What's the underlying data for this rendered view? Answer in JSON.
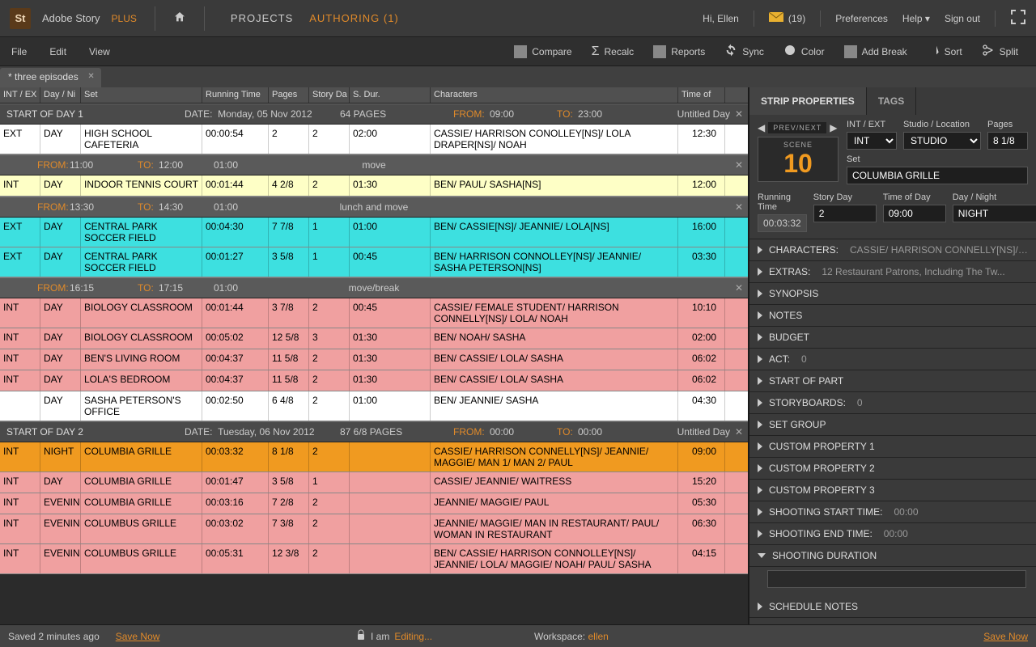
{
  "brand": {
    "product": "Adobe Story",
    "tier": "PLUS",
    "nav": {
      "projects": "PROJECTS",
      "authoring": "AUTHORING (1)"
    },
    "greeting": "Hi, Ellen",
    "mail_count": "(19)",
    "prefs": "Preferences",
    "help": "Help",
    "signout": "Sign out"
  },
  "menu": {
    "file": "File",
    "edit": "Edit",
    "view": "View",
    "tools": {
      "compare": "Compare",
      "recalc": "Recalc",
      "reports": "Reports",
      "sync": "Sync",
      "color": "Color",
      "addbreak": "Add Break",
      "sort": "Sort",
      "split": "Split"
    }
  },
  "tab": {
    "title": "* three episodes"
  },
  "cols": {
    "ie": "INT / EX",
    "dn": "Day / Ni",
    "set": "Set",
    "rt": "Running Time",
    "pg": "Pages",
    "sd": "Story Da",
    "sdur": "S. Dur.",
    "ch": "Characters",
    "to": "Time of"
  },
  "days": [
    {
      "title": "START OF DAY  1",
      "date": "Monday, 05 Nov 2012",
      "pages": "64  PAGES",
      "from": "09:00",
      "to": "23:00",
      "name": "Untitled Day"
    },
    {
      "title": "START OF DAY  2",
      "date": "Tuesday, 06 Nov 2012",
      "pages": "87 6/8  PAGES",
      "from": "00:00",
      "to": "00:00",
      "name": "Untitled Day"
    }
  ],
  "breaks": [
    {
      "from": "11:00",
      "to": "12:00",
      "dur": "01:00",
      "name": "move"
    },
    {
      "from": "13:30",
      "to": "14:30",
      "dur": "01:00",
      "name": "lunch and move"
    },
    {
      "from": "16:15",
      "to": "17:15",
      "dur": "01:00",
      "name": "move/break"
    }
  ],
  "strips": [
    {
      "c": "white",
      "ie": "EXT",
      "dn": "DAY",
      "set": "HIGH SCHOOL CAFETERIA",
      "rt": "00:00:54",
      "pg": "2",
      "sd": "2",
      "sdur": "02:00",
      "ch": "CASSIE/ HARRISON CONOLLEY[NS]/ LOLA DRAPER[NS]/ NOAH",
      "to": "12:30"
    },
    {
      "c": "yellow",
      "ie": "INT",
      "dn": "DAY",
      "set": "INDOOR TENNIS COURT",
      "rt": "00:01:44",
      "pg": "4 2/8",
      "sd": "2",
      "sdur": "01:30",
      "ch": "BEN/ PAUL/ SASHA[NS]",
      "to": "12:00"
    },
    {
      "c": "cyan",
      "ie": "EXT",
      "dn": "DAY",
      "set": "CENTRAL PARK SOCCER FIELD",
      "rt": "00:04:30",
      "pg": "7 7/8",
      "sd": "1",
      "sdur": "01:00",
      "ch": "BEN/ CASSIE[NS]/ JEANNIE/ LOLA[NS]",
      "to": "16:00"
    },
    {
      "c": "cyan",
      "ie": "EXT",
      "dn": "DAY",
      "set": "CENTRAL PARK SOCCER FIELD",
      "rt": "00:01:27",
      "pg": "3 5/8",
      "sd": "1",
      "sdur": "00:45",
      "ch": "BEN/ HARRISON CONNOLLEY[NS]/ JEANNIE/ SASHA PETERSON[NS]",
      "to": "03:30"
    },
    {
      "c": "pink",
      "ie": "INT",
      "dn": "DAY",
      "set": "BIOLOGY CLASSROOM",
      "rt": "00:01:44",
      "pg": "3 7/8",
      "sd": "2",
      "sdur": "00:45",
      "ch": "CASSIE/ FEMALE STUDENT/ HARRISON CONNELLY[NS]/ LOLA/ NOAH",
      "to": "10:10"
    },
    {
      "c": "pink",
      "ie": "INT",
      "dn": "DAY",
      "set": "BIOLOGY CLASSROOM",
      "rt": "00:05:02",
      "pg": "12 5/8",
      "sd": "3",
      "sdur": "01:30",
      "ch": "BEN/ NOAH/ SASHA",
      "to": "02:00"
    },
    {
      "c": "pink",
      "ie": "INT",
      "dn": "DAY",
      "set": "BEN'S LIVING ROOM",
      "rt": "00:04:37",
      "pg": "11 5/8",
      "sd": "2",
      "sdur": "01:30",
      "ch": "BEN/ CASSIE/ LOLA/ SASHA",
      "to": "06:02"
    },
    {
      "c": "pink",
      "ie": "INT",
      "dn": "DAY",
      "set": "LOLA'S BEDROOM",
      "rt": "00:04:37",
      "pg": "11 5/8",
      "sd": "2",
      "sdur": "01:30",
      "ch": "BEN/ CASSIE/ LOLA/ SASHA",
      "to": "06:02"
    },
    {
      "c": "white",
      "ie": "",
      "dn": "DAY",
      "set": "SASHA PETERSON'S OFFICE",
      "rt": "00:02:50",
      "pg": "6 4/8",
      "sd": "2",
      "sdur": "01:00",
      "ch": "BEN/ JEANNIE/ SASHA",
      "to": "04:30"
    },
    {
      "c": "orange",
      "ie": "INT",
      "dn": "NIGHT",
      "set": "COLUMBIA GRILLE",
      "rt": "00:03:32",
      "pg": "8 1/8",
      "sd": "2",
      "sdur": "",
      "ch": "CASSIE/ HARRISON CONNELLY[NS]/ JEANNIE/ MAGGIE/ MAN 1/ MAN 2/ PAUL",
      "to": "09:00"
    },
    {
      "c": "pink",
      "ie": "INT",
      "dn": "DAY",
      "set": "COLUMBIA GRILLE",
      "rt": "00:01:47",
      "pg": "3 5/8",
      "sd": "1",
      "sdur": "",
      "ch": "CASSIE/ JEANNIE/ WAITRESS",
      "to": "15:20"
    },
    {
      "c": "pink",
      "ie": "INT",
      "dn": "EVENING",
      "set": "COLUMBIA GRILLE",
      "rt": "00:03:16",
      "pg": "7 2/8",
      "sd": "2",
      "sdur": "",
      "ch": "JEANNIE/ MAGGIE/ PAUL",
      "to": "05:30"
    },
    {
      "c": "pink",
      "ie": "INT",
      "dn": "EVENING",
      "set": "COLUMBUS GRILLE",
      "rt": "00:03:02",
      "pg": "7 3/8",
      "sd": "2",
      "sdur": "",
      "ch": "JEANNIE/ MAGGIE/ MAN IN RESTAURANT/ PAUL/ WOMAN IN RESTAURANT",
      "to": "06:30"
    },
    {
      "c": "pink",
      "ie": "INT",
      "dn": "EVENING",
      "set": "COLUMBUS GRILLE",
      "rt": "00:05:31",
      "pg": "12 3/8",
      "sd": "2",
      "sdur": "",
      "ch": "BEN/ CASSIE/ HARRISON CONNOLLEY[NS]/ JEANNIE/ LOLA/ MAGGIE/ NOAH/ PAUL/ SASHA",
      "to": "04:15"
    }
  ],
  "labels": {
    "from": "FROM:",
    "to": "TO:",
    "date": "DATE:"
  },
  "side": {
    "tabs": {
      "props": "STRIP PROPERTIES",
      "tags": "TAGS"
    },
    "prevnext": "PREV/NEXT",
    "scene_lbl": "SCENE",
    "scene_num": "10",
    "intext_lbl": "INT / EXT",
    "intext": "INT",
    "studio_lbl": "Studio / Location",
    "studio": "STUDIO",
    "pages_lbl": "Pages",
    "pages": "8 1/8",
    "set_lbl": "Set",
    "set": "COLUMBIA GRILLE",
    "rt_lbl": "Running Time",
    "rt": "00:03:32",
    "sd_lbl": "Story Day",
    "sd": "2",
    "tod_lbl": "Time of Day",
    "tod": "09:00",
    "dn_lbl": "Day / Night",
    "dn": "NIGHT",
    "acc": {
      "characters_k": "CHARACTERS:",
      "characters_v": "CASSIE/ HARRISON CONNELLY[NS]/ JEA...",
      "extras_k": "EXTRAS:",
      "extras_v": "12 Restaurant Patrons, Including The Tw...",
      "synopsis": "SYNOPSIS",
      "notes": "NOTES",
      "budget": "BUDGET",
      "act_k": "ACT:",
      "act_v": "0",
      "startpart": "START OF PART",
      "storyboards_k": "STORYBOARDS:",
      "storyboards_v": "0",
      "setgroup": "SET GROUP",
      "cp1": "CUSTOM PROPERTY 1",
      "cp2": "CUSTOM PROPERTY 2",
      "cp3": "CUSTOM PROPERTY 3",
      "sst_k": "SHOOTING START TIME:",
      "sst_v": "00:00",
      "set_k": "SHOOTING END TIME:",
      "set_v": "00:00",
      "sdur": "SHOOTING DURATION",
      "snotes": "SCHEDULE NOTES"
    }
  },
  "status": {
    "saved": "Saved 2 minutes ago",
    "savenow": "Save Now",
    "iam": "I am",
    "editing": "Editing...",
    "ws_lbl": "Workspace:",
    "ws": "ellen"
  }
}
